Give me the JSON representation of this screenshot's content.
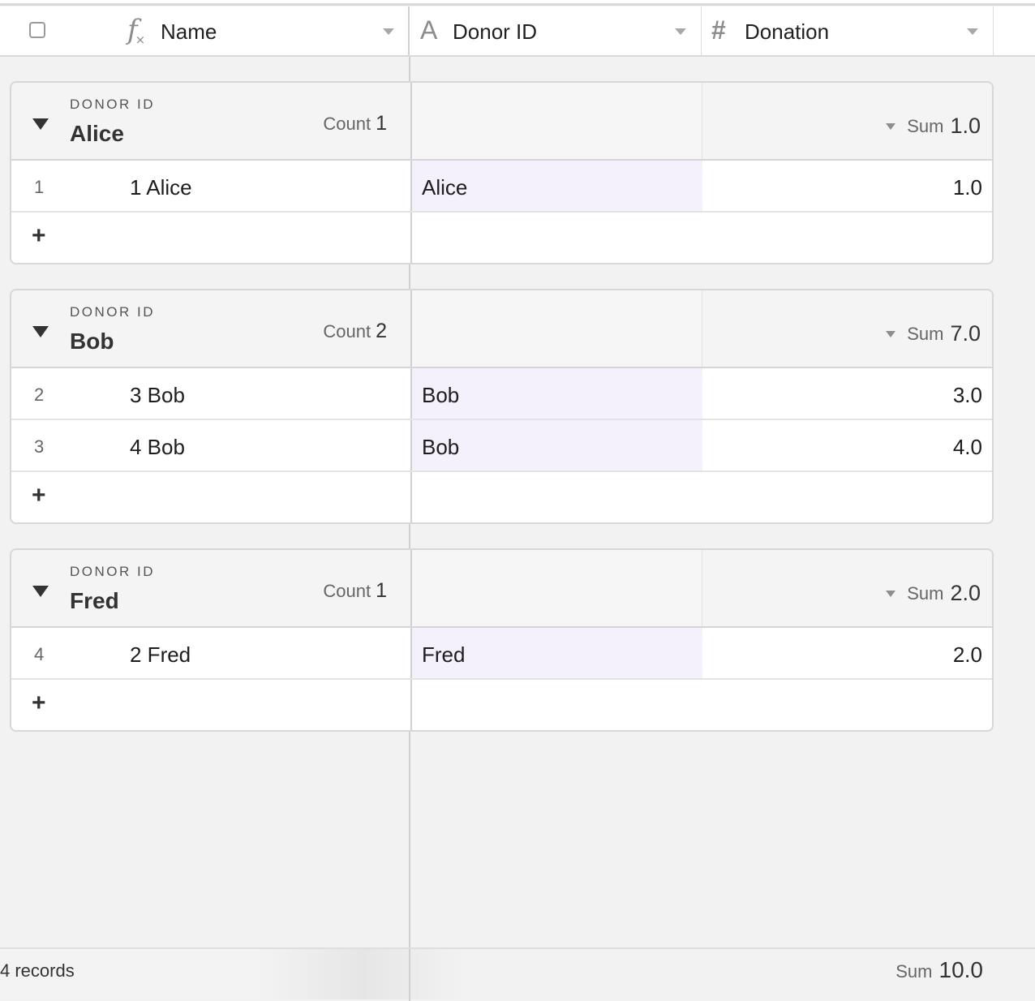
{
  "header": {
    "columns": [
      {
        "label": "Name",
        "icon": "formula-icon"
      },
      {
        "label": "Donor ID",
        "icon": "text-field-icon"
      },
      {
        "label": "Donation",
        "icon": "number-field-icon"
      }
    ]
  },
  "groups": [
    {
      "label": "DONOR ID",
      "value": "Alice",
      "count_label": "Count",
      "count": "1",
      "sum_label": "Sum",
      "sum": "1.0",
      "rows": [
        {
          "index": "1",
          "name": "1 Alice",
          "donor_id": "Alice",
          "donation": "1.0"
        }
      ]
    },
    {
      "label": "DONOR ID",
      "value": "Bob",
      "count_label": "Count",
      "count": "2",
      "sum_label": "Sum",
      "sum": "7.0",
      "rows": [
        {
          "index": "2",
          "name": "3 Bob",
          "donor_id": "Bob",
          "donation": "3.0"
        },
        {
          "index": "3",
          "name": "4 Bob",
          "donor_id": "Bob",
          "donation": "4.0"
        }
      ]
    },
    {
      "label": "DONOR ID",
      "value": "Fred",
      "count_label": "Count",
      "count": "1",
      "sum_label": "Sum",
      "sum": "2.0",
      "rows": [
        {
          "index": "4",
          "name": "2 Fred",
          "donor_id": "Fred",
          "donation": "2.0"
        }
      ]
    }
  ],
  "add_row_symbol": "+",
  "footer": {
    "records": "4 records",
    "sum_label": "Sum",
    "sum": "10.0"
  },
  "colors": {
    "background": "#f2f2f2",
    "donor_cell": "#f4f1fc",
    "border": "#d6d6d6"
  }
}
